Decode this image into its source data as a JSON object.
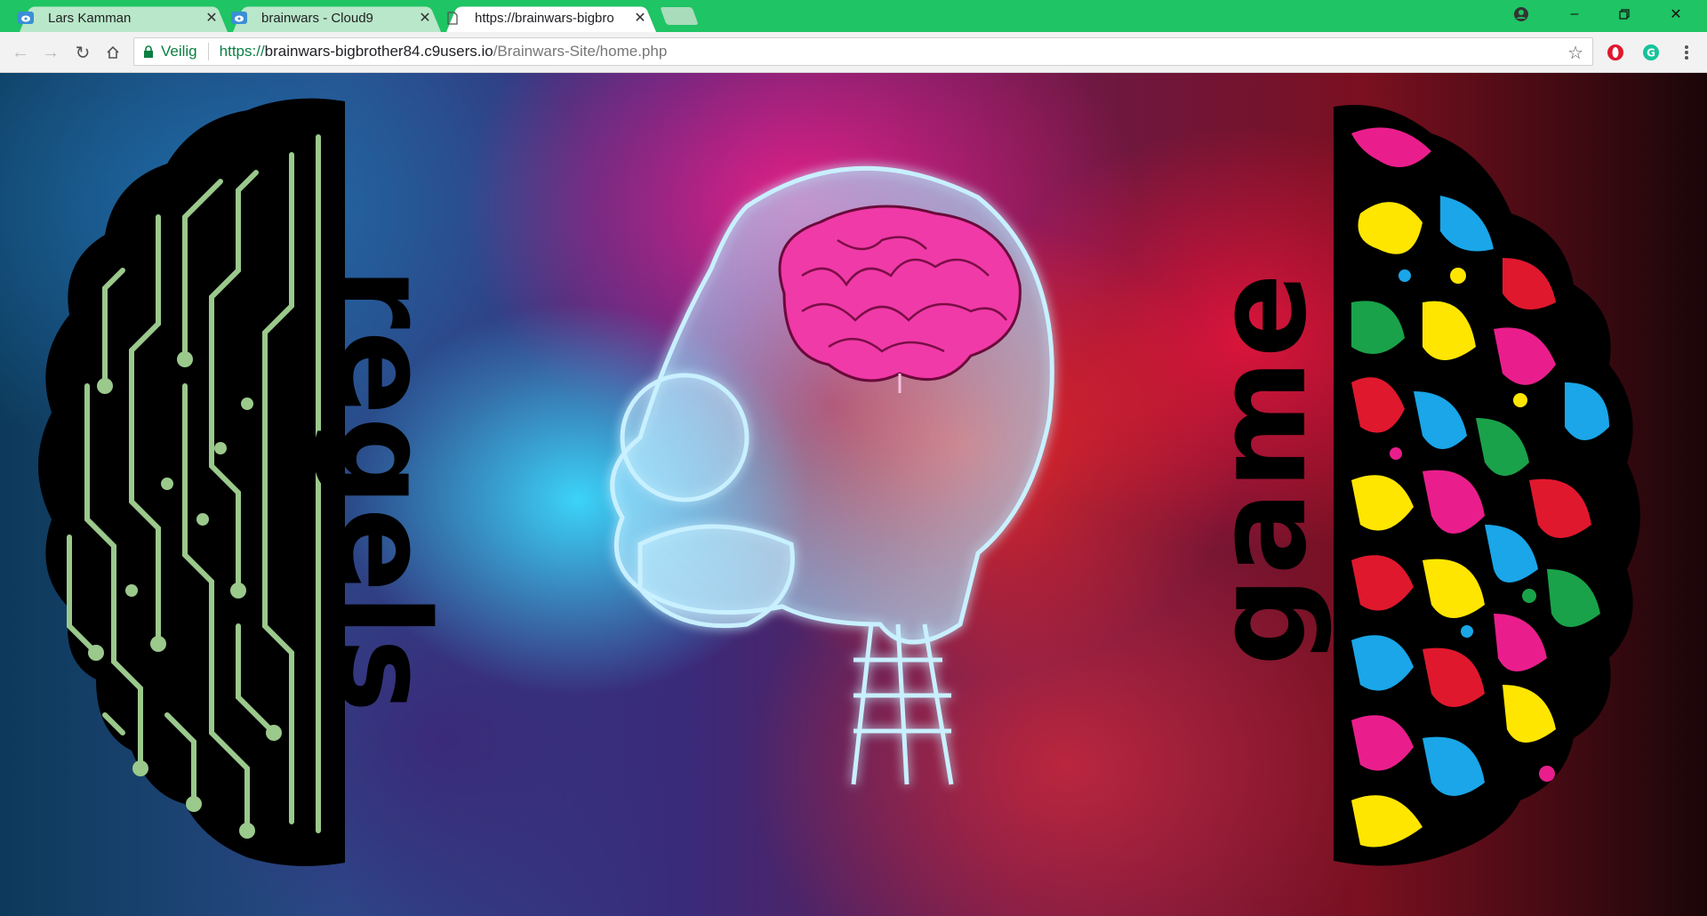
{
  "browser": {
    "tabs": [
      {
        "title": "Lars Kamman",
        "favicon": "cloud9-icon",
        "active": false
      },
      {
        "title": "brainwars - Cloud9",
        "favicon": "cloud9-icon",
        "active": false
      },
      {
        "title": "https://brainwars-bigbro",
        "favicon": "document-icon",
        "active": true
      }
    ],
    "address": {
      "secure_label": "Veilig",
      "scheme": "https://",
      "host": "brainwars-bigbrother84.c9users.io",
      "path": "/Brainwars-Site/home.php"
    },
    "colors": {
      "frame": "#1fc464",
      "secure": "#0b8043"
    }
  },
  "page": {
    "left_link": "regels",
    "right_link": "game"
  }
}
